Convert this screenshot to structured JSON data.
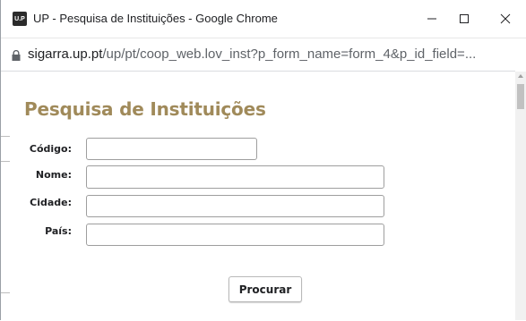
{
  "window": {
    "title": "UP - Pesquisa de Instituições - Google Chrome",
    "favicon_text": "U.P",
    "controls": {
      "minimize": "—",
      "maximize": "☐",
      "close": "✕"
    }
  },
  "address_bar": {
    "host": "sigarra.up.pt",
    "path": "/up/pt/coop_web.lov_inst?p_form_name=form_4&p_id_field=..."
  },
  "page": {
    "heading": "Pesquisa de Instituições",
    "form": {
      "codigo_label": "Código:",
      "codigo_value": "",
      "nome_label": "Nome:",
      "nome_value": "",
      "cidade_label": "Cidade:",
      "cidade_value": "",
      "pais_label": "País:",
      "pais_value": "",
      "submit_label": "Procurar"
    }
  },
  "colors": {
    "heading": "#a08a5a",
    "text": "#202124"
  }
}
